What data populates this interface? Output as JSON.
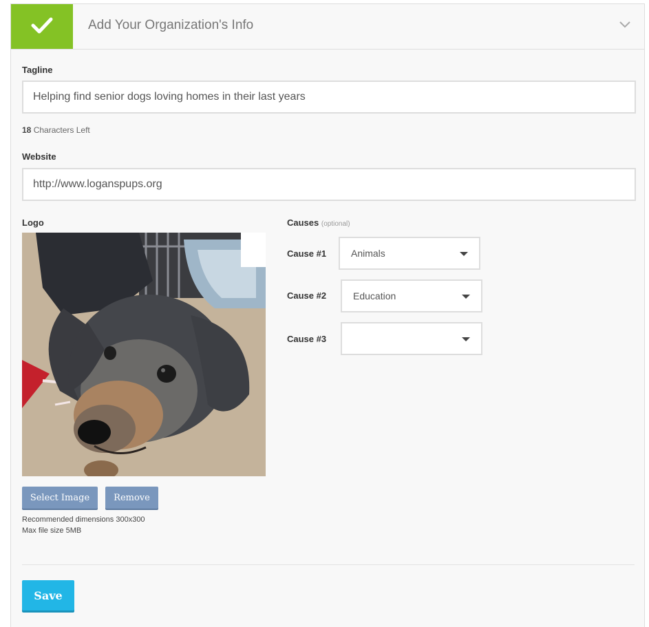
{
  "header": {
    "title": "Add Your Organization's Info",
    "status_icon": "check-icon",
    "toggle_icon": "chevron-down-icon",
    "accent_color": "#84c225"
  },
  "tagline": {
    "label": "Tagline",
    "value": "Helping find senior dogs loving homes in their last years",
    "chars_left_count": "18",
    "chars_left_text": "Characters Left"
  },
  "website": {
    "label": "Website",
    "value": "http://www.loganspups.org"
  },
  "logo": {
    "label": "Logo",
    "select_label": "Select Image",
    "remove_label": "Remove",
    "recommended": "Recommended dimensions 300x300",
    "max_size": "Max file size 5MB"
  },
  "causes": {
    "title": "Causes",
    "optional": "(optional)",
    "items": [
      {
        "label": "Cause #1",
        "value": "Animals"
      },
      {
        "label": "Cause #2",
        "value": "Education"
      },
      {
        "label": "Cause #3",
        "value": ""
      }
    ]
  },
  "actions": {
    "save_label": "Save",
    "save_color": "#22b6e6"
  }
}
